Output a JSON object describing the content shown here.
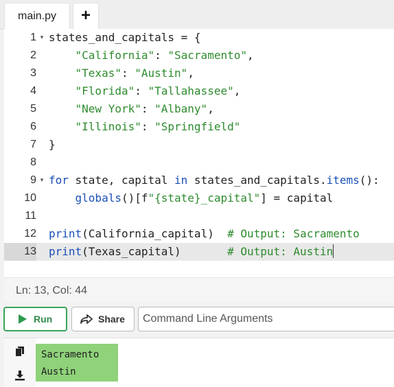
{
  "tabs": {
    "file_name": "main.py",
    "add_label": "+"
  },
  "editor": {
    "lines": [
      {
        "num": "1",
        "fold": true,
        "tokens": [
          [
            "p",
            "states_and_capitals = {"
          ]
        ]
      },
      {
        "num": "2",
        "fold": false,
        "tokens": [
          [
            "p",
            "    "
          ],
          [
            "s",
            "\"California\""
          ],
          [
            "p",
            ": "
          ],
          [
            "s",
            "\"Sacramento\""
          ],
          [
            "p",
            ","
          ]
        ]
      },
      {
        "num": "3",
        "fold": false,
        "tokens": [
          [
            "p",
            "    "
          ],
          [
            "s",
            "\"Texas\""
          ],
          [
            "p",
            ": "
          ],
          [
            "s",
            "\"Austin\""
          ],
          [
            "p",
            ","
          ]
        ]
      },
      {
        "num": "4",
        "fold": false,
        "tokens": [
          [
            "p",
            "    "
          ],
          [
            "s",
            "\"Florida\""
          ],
          [
            "p",
            ": "
          ],
          [
            "s",
            "\"Tallahassee\""
          ],
          [
            "p",
            ","
          ]
        ]
      },
      {
        "num": "5",
        "fold": false,
        "tokens": [
          [
            "p",
            "    "
          ],
          [
            "s",
            "\"New York\""
          ],
          [
            "p",
            ": "
          ],
          [
            "s",
            "\"Albany\""
          ],
          [
            "p",
            ","
          ]
        ]
      },
      {
        "num": "6",
        "fold": false,
        "tokens": [
          [
            "p",
            "    "
          ],
          [
            "s",
            "\"Illinois\""
          ],
          [
            "p",
            ": "
          ],
          [
            "s",
            "\"Springfield\""
          ]
        ]
      },
      {
        "num": "7",
        "fold": false,
        "tokens": [
          [
            "p",
            "}"
          ]
        ]
      },
      {
        "num": "8",
        "fold": false,
        "tokens": []
      },
      {
        "num": "9",
        "fold": true,
        "tokens": [
          [
            "k",
            "for"
          ],
          [
            "p",
            " state, capital "
          ],
          [
            "k",
            "in"
          ],
          [
            "p",
            " states_and_capitals."
          ],
          [
            "k",
            "items"
          ],
          [
            "p",
            "():"
          ]
        ]
      },
      {
        "num": "10",
        "fold": false,
        "tokens": [
          [
            "p",
            "    "
          ],
          [
            "k",
            "globals"
          ],
          [
            "p",
            "()[f"
          ],
          [
            "s",
            "\"{state}_capital\""
          ],
          [
            "p",
            "] = capital"
          ]
        ]
      },
      {
        "num": "11",
        "fold": false,
        "tokens": []
      },
      {
        "num": "12",
        "fold": false,
        "tokens": [
          [
            "k",
            "print"
          ],
          [
            "p",
            "(California_capital)  "
          ],
          [
            "c",
            "# Output: Sacramento"
          ]
        ]
      },
      {
        "num": "13",
        "fold": false,
        "active": true,
        "cursor": true,
        "tokens": [
          [
            "k",
            "print"
          ],
          [
            "p",
            "(Texas_capital)       "
          ],
          [
            "c",
            "# Output: Austin"
          ]
        ]
      }
    ]
  },
  "status": {
    "position": "Ln: 13,  Col: 44"
  },
  "toolbar": {
    "run_label": "Run",
    "share_label": "Share",
    "args_placeholder": "Command Line Arguments"
  },
  "output": {
    "lines": [
      "Sacramento",
      "Austin"
    ]
  },
  "icons": {
    "run": "play-icon",
    "share": "share-arrow-icon",
    "copy": "copy-icon",
    "download": "download-icon"
  },
  "colors": {
    "run_green": "#3aa35a",
    "string_green": "#2e8b2e",
    "keyword_blue": "#1a4fb8",
    "output_bg": "#8fd27a"
  }
}
